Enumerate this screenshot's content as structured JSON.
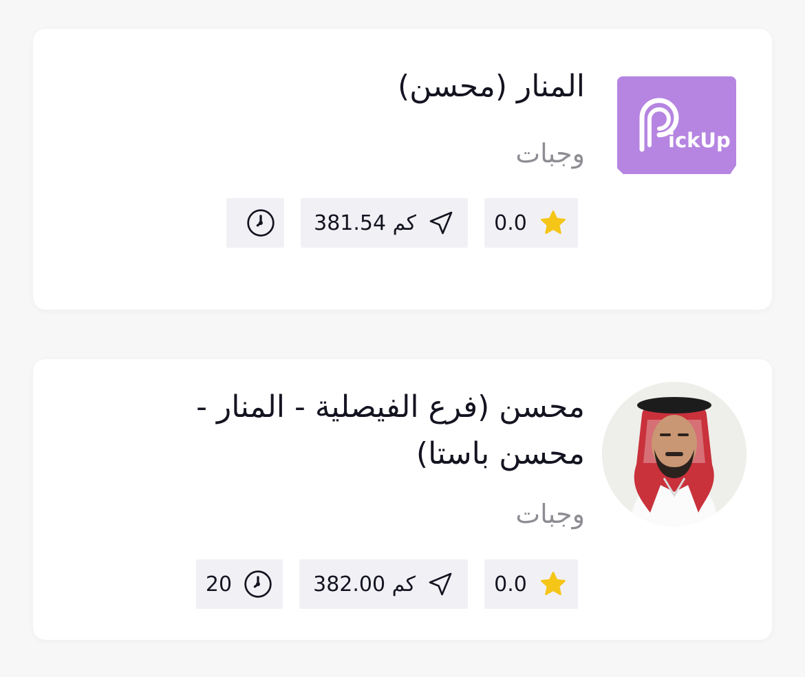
{
  "restaurants": [
    {
      "name": "المنار (محسن)",
      "category": "وجبات",
      "logo_text": "ickUp",
      "rating": "0.0",
      "distance": "381.54 كم",
      "time": ""
    },
    {
      "name_line1": "محسن (فرع الفيصلية - المنار -",
      "name_line2": "محسن باستا)",
      "category": "وجبات",
      "rating": "0.0",
      "distance": "382.00 كم",
      "time": "20"
    }
  ],
  "icons": {
    "rating": "star-icon",
    "distance": "location-arrow-icon",
    "time": "clock-icon",
    "logo": "pickup-logo"
  },
  "colors": {
    "star": "#f5c518",
    "logo_bg": "#b585e1",
    "chip_bg": "#f1f1f5",
    "title": "#141421",
    "category": "#8d8d93"
  }
}
